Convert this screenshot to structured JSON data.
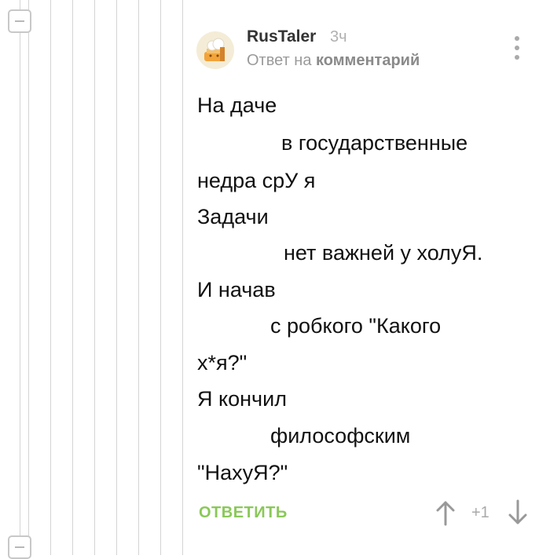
{
  "comment": {
    "author": "RusTaler",
    "time": "3ч",
    "reply_prefix": "Ответ на",
    "reply_link": "комментарий",
    "lines": [
      "На даче",
      "в государственные",
      "недра срУ я",
      "Задачи",
      "нет важней у холуЯ.",
      "И начав",
      "с робкого \"Какого",
      "х*я?\"",
      "Я кончил",
      "философским",
      "\"НахуЯ?\""
    ],
    "reply_button": "ОТВЕТИТЬ",
    "rating": "+1"
  },
  "colors": {
    "reply_button": "#8ac858",
    "thread_line": "#d4d4d4"
  },
  "icons": [
    "collapse-icon",
    "avatar",
    "more-vertical-icon",
    "arrow-up-icon",
    "arrow-down-icon"
  ]
}
